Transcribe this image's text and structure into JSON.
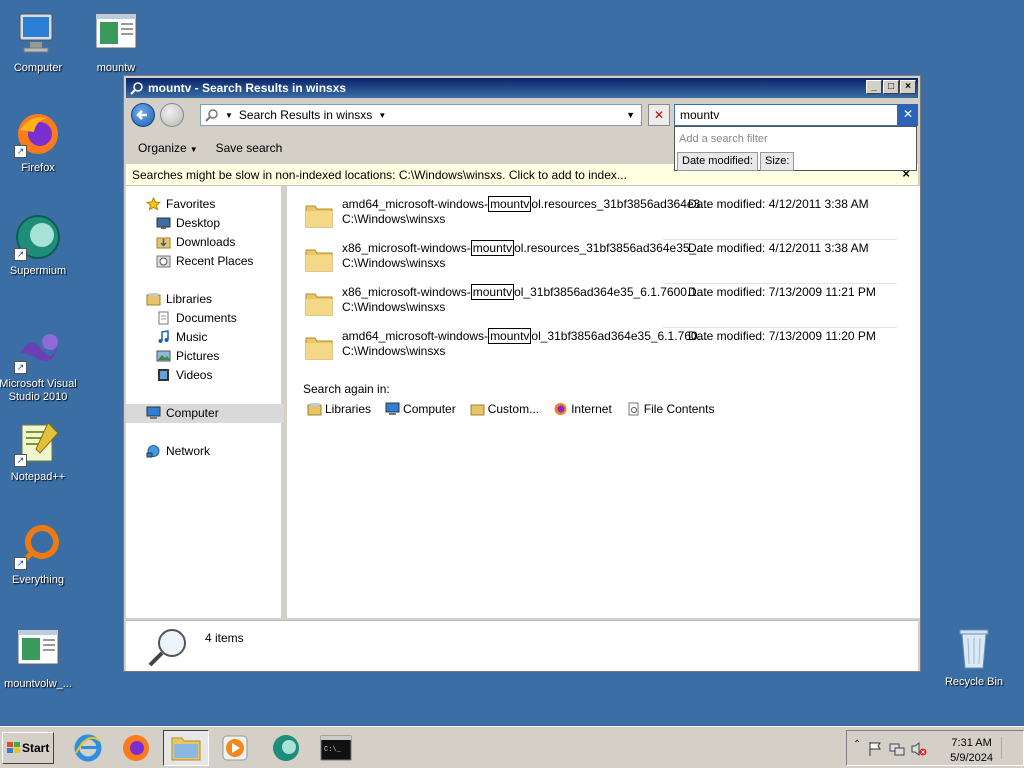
{
  "desktop": {
    "icons": [
      {
        "label": "Computer"
      },
      {
        "label": "mountw"
      },
      {
        "label": "Firefox"
      },
      {
        "label": "Supermium"
      },
      {
        "label": "Microsoft Visual Studio 2010"
      },
      {
        "label": "Notepad++"
      },
      {
        "label": "Everything"
      },
      {
        "label": "mountvolw_..."
      },
      {
        "label": "Recycle Bin"
      }
    ]
  },
  "window": {
    "title": "mountv - Search Results in winsxs",
    "address": "Search Results in winsxs",
    "search_value": "mountv",
    "search_filter": {
      "hint": "Add a search filter",
      "filters": [
        "Date modified:",
        "Size:"
      ]
    },
    "toolbar": {
      "organize": "Organize",
      "save_search": "Save search"
    },
    "infobar": "Searches might be slow in non-indexed locations: C:\\Windows\\winsxs. Click to add to index...",
    "nav": {
      "favorites": "Favorites",
      "desktop": "Desktop",
      "downloads": "Downloads",
      "recent": "Recent Places",
      "libraries": "Libraries",
      "documents": "Documents",
      "music": "Music",
      "pictures": "Pictures",
      "videos": "Videos",
      "computer": "Computer",
      "network": "Network"
    },
    "results": [
      {
        "pre": "amd64_microsoft-windows-",
        "match": "mountv",
        "post": "ol.resources_31bf3856ad364e3...",
        "path": "C:\\Windows\\winsxs",
        "date": "Date modified: 4/12/2011 3:38 AM"
      },
      {
        "pre": "x86_microsoft-windows-",
        "match": "mountv",
        "post": "ol.resources_31bf3856ad364e35_...",
        "path": "C:\\Windows\\winsxs",
        "date": "Date modified: 4/12/2011 3:38 AM"
      },
      {
        "pre": "x86_microsoft-windows-",
        "match": "mountv",
        "post": "ol_31bf3856ad364e35_6.1.7600.1...",
        "path": "C:\\Windows\\winsxs",
        "date": "Date modified: 7/13/2009 11:21 PM"
      },
      {
        "pre": "amd64_microsoft-windows-",
        "match": "mountv",
        "post": "ol_31bf3856ad364e35_6.1.760...",
        "path": "C:\\Windows\\winsxs",
        "date": "Date modified: 7/13/2009 11:20 PM"
      }
    ],
    "search_again": {
      "label": "Search again in:",
      "items": [
        "Libraries",
        "Computer",
        "Custom...",
        "Internet",
        "File Contents"
      ]
    },
    "details": {
      "count": "4 items"
    }
  },
  "taskbar": {
    "start": "Start",
    "time": "7:31 AM",
    "date": "5/9/2024"
  },
  "colors": {
    "desktop": "#3a6ea5",
    "titlebar": "#0a246a",
    "infobar": "#ffffe1"
  }
}
